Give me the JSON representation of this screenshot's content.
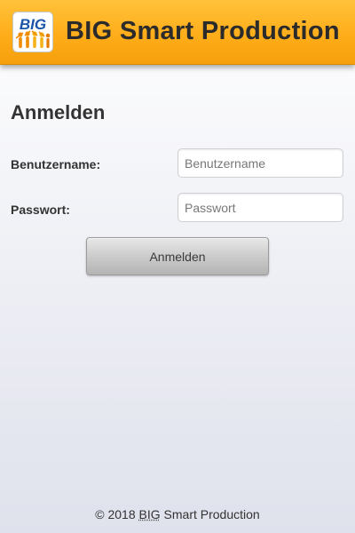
{
  "header": {
    "logo_text": "BIG",
    "title": "BIG Smart Production",
    "brand_color": "#ffad1a"
  },
  "login": {
    "heading": "Anmelden",
    "username_label": "Benutzername:",
    "username_placeholder": "Benutzername",
    "username_value": "",
    "password_label": "Passwort:",
    "password_placeholder": "Passwort",
    "password_value": "",
    "submit_label": "Anmelden"
  },
  "footer": {
    "copyright_prefix": "© 2018 ",
    "company_abbr": "BIG",
    "copyright_suffix": " Smart Production"
  }
}
